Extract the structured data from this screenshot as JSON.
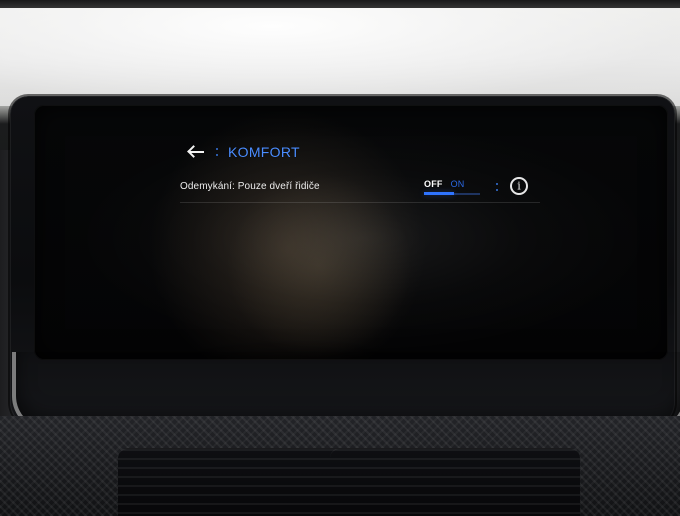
{
  "screen": {
    "header": {
      "title": "KOMFORT",
      "icons": {
        "back": "back-arrow-icon",
        "separator": "separator-dots-icon"
      }
    },
    "settings": {
      "rows": [
        {
          "label": "Odemykání: Pouze dveří řidiče",
          "toggle": {
            "options": [
              "OFF",
              "ON"
            ],
            "selected": "OFF",
            "accent": "#2f74ff"
          },
          "info_icon": "info-icon"
        }
      ]
    }
  }
}
